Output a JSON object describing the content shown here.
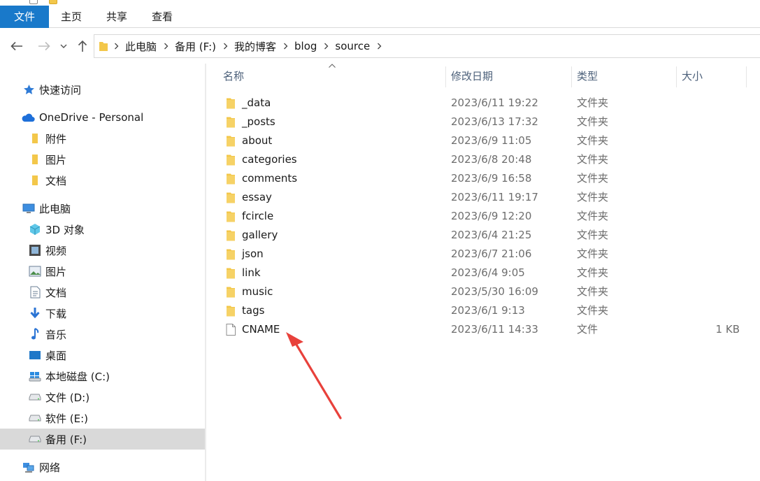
{
  "ribbon": {
    "tabs": [
      {
        "label": "文件"
      },
      {
        "label": "主页"
      },
      {
        "label": "共享"
      },
      {
        "label": "查看"
      }
    ]
  },
  "address": {
    "breadcrumbs": [
      "此电脑",
      "备用 (F:)",
      "我的博客",
      "blog",
      "source"
    ]
  },
  "sidebar": {
    "items": [
      {
        "label": "快速访问",
        "icon": "star-icon"
      },
      {
        "label": "OneDrive - Personal",
        "icon": "cloud-icon"
      },
      {
        "label": "附件",
        "icon": "folder-icon"
      },
      {
        "label": "图片",
        "icon": "folder-icon"
      },
      {
        "label": "文档",
        "icon": "folder-icon"
      },
      {
        "label": "此电脑",
        "icon": "computer-icon"
      },
      {
        "label": "3D 对象",
        "icon": "cube-icon"
      },
      {
        "label": "视频",
        "icon": "video-icon"
      },
      {
        "label": "图片",
        "icon": "picture-icon"
      },
      {
        "label": "文档",
        "icon": "document-icon"
      },
      {
        "label": "下载",
        "icon": "download-icon"
      },
      {
        "label": "音乐",
        "icon": "music-icon"
      },
      {
        "label": "桌面",
        "icon": "desktop-icon"
      },
      {
        "label": "本地磁盘 (C:)",
        "icon": "windows-drive-icon"
      },
      {
        "label": "文件 (D:)",
        "icon": "drive-icon"
      },
      {
        "label": "软件 (E:)",
        "icon": "drive-icon"
      },
      {
        "label": "备用 (F:)",
        "icon": "drive-icon"
      },
      {
        "label": "网络",
        "icon": "network-icon"
      }
    ],
    "selected": "备用 (F:)"
  },
  "columns": {
    "name": "名称",
    "date": "修改日期",
    "type": "类型",
    "size": "大小"
  },
  "files": [
    {
      "name": "_data",
      "date": "2023/6/11 19:22",
      "type": "文件夹",
      "size": "",
      "kind": "folder"
    },
    {
      "name": "_posts",
      "date": "2023/6/13 17:32",
      "type": "文件夹",
      "size": "",
      "kind": "folder"
    },
    {
      "name": "about",
      "date": "2023/6/9 11:05",
      "type": "文件夹",
      "size": "",
      "kind": "folder"
    },
    {
      "name": "categories",
      "date": "2023/6/8 20:48",
      "type": "文件夹",
      "size": "",
      "kind": "folder"
    },
    {
      "name": "comments",
      "date": "2023/6/9 16:58",
      "type": "文件夹",
      "size": "",
      "kind": "folder"
    },
    {
      "name": "essay",
      "date": "2023/6/11 19:17",
      "type": "文件夹",
      "size": "",
      "kind": "folder"
    },
    {
      "name": "fcircle",
      "date": "2023/6/9 12:20",
      "type": "文件夹",
      "size": "",
      "kind": "folder"
    },
    {
      "name": "gallery",
      "date": "2023/6/4 21:25",
      "type": "文件夹",
      "size": "",
      "kind": "folder"
    },
    {
      "name": "json",
      "date": "2023/6/7 21:06",
      "type": "文件夹",
      "size": "",
      "kind": "folder"
    },
    {
      "name": "link",
      "date": "2023/6/4 9:05",
      "type": "文件夹",
      "size": "",
      "kind": "folder"
    },
    {
      "name": "music",
      "date": "2023/5/30 16:09",
      "type": "文件夹",
      "size": "",
      "kind": "folder"
    },
    {
      "name": "tags",
      "date": "2023/6/1 9:13",
      "type": "文件夹",
      "size": "",
      "kind": "folder"
    },
    {
      "name": "CNAME",
      "date": "2023/6/11 14:33",
      "type": "文件",
      "size": "1 KB",
      "kind": "file"
    }
  ],
  "colors": {
    "accent": "#1979ca",
    "folder": "#f3c74a",
    "annotation_arrow": "#e8413b",
    "selected_bg": "#d9d9d9"
  }
}
